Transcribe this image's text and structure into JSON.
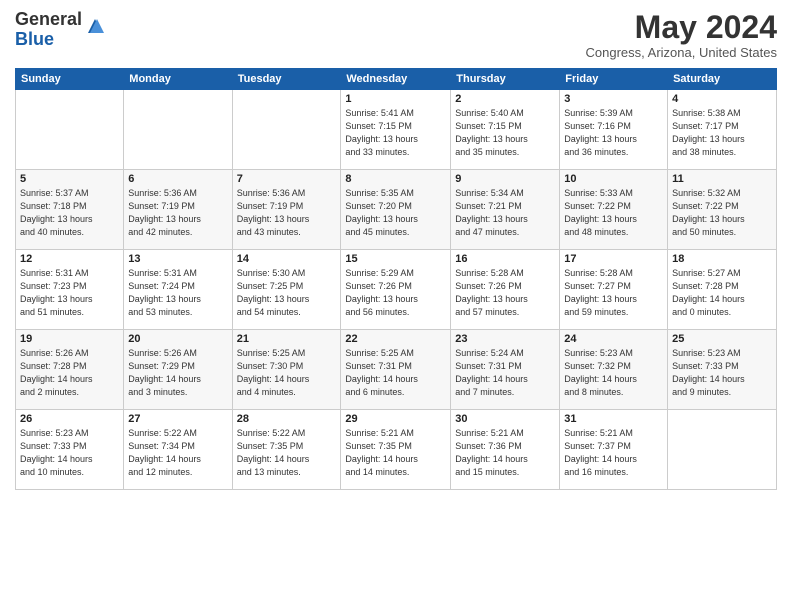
{
  "header": {
    "logo_general": "General",
    "logo_blue": "Blue",
    "month_title": "May 2024",
    "location": "Congress, Arizona, United States"
  },
  "days_of_week": [
    "Sunday",
    "Monday",
    "Tuesday",
    "Wednesday",
    "Thursday",
    "Friday",
    "Saturday"
  ],
  "weeks": [
    {
      "days": [
        {
          "number": "",
          "info": ""
        },
        {
          "number": "",
          "info": ""
        },
        {
          "number": "",
          "info": ""
        },
        {
          "number": "1",
          "info": "Sunrise: 5:41 AM\nSunset: 7:15 PM\nDaylight: 13 hours\nand 33 minutes."
        },
        {
          "number": "2",
          "info": "Sunrise: 5:40 AM\nSunset: 7:15 PM\nDaylight: 13 hours\nand 35 minutes."
        },
        {
          "number": "3",
          "info": "Sunrise: 5:39 AM\nSunset: 7:16 PM\nDaylight: 13 hours\nand 36 minutes."
        },
        {
          "number": "4",
          "info": "Sunrise: 5:38 AM\nSunset: 7:17 PM\nDaylight: 13 hours\nand 38 minutes."
        }
      ]
    },
    {
      "days": [
        {
          "number": "5",
          "info": "Sunrise: 5:37 AM\nSunset: 7:18 PM\nDaylight: 13 hours\nand 40 minutes."
        },
        {
          "number": "6",
          "info": "Sunrise: 5:36 AM\nSunset: 7:19 PM\nDaylight: 13 hours\nand 42 minutes."
        },
        {
          "number": "7",
          "info": "Sunrise: 5:36 AM\nSunset: 7:19 PM\nDaylight: 13 hours\nand 43 minutes."
        },
        {
          "number": "8",
          "info": "Sunrise: 5:35 AM\nSunset: 7:20 PM\nDaylight: 13 hours\nand 45 minutes."
        },
        {
          "number": "9",
          "info": "Sunrise: 5:34 AM\nSunset: 7:21 PM\nDaylight: 13 hours\nand 47 minutes."
        },
        {
          "number": "10",
          "info": "Sunrise: 5:33 AM\nSunset: 7:22 PM\nDaylight: 13 hours\nand 48 minutes."
        },
        {
          "number": "11",
          "info": "Sunrise: 5:32 AM\nSunset: 7:22 PM\nDaylight: 13 hours\nand 50 minutes."
        }
      ]
    },
    {
      "days": [
        {
          "number": "12",
          "info": "Sunrise: 5:31 AM\nSunset: 7:23 PM\nDaylight: 13 hours\nand 51 minutes."
        },
        {
          "number": "13",
          "info": "Sunrise: 5:31 AM\nSunset: 7:24 PM\nDaylight: 13 hours\nand 53 minutes."
        },
        {
          "number": "14",
          "info": "Sunrise: 5:30 AM\nSunset: 7:25 PM\nDaylight: 13 hours\nand 54 minutes."
        },
        {
          "number": "15",
          "info": "Sunrise: 5:29 AM\nSunset: 7:26 PM\nDaylight: 13 hours\nand 56 minutes."
        },
        {
          "number": "16",
          "info": "Sunrise: 5:28 AM\nSunset: 7:26 PM\nDaylight: 13 hours\nand 57 minutes."
        },
        {
          "number": "17",
          "info": "Sunrise: 5:28 AM\nSunset: 7:27 PM\nDaylight: 13 hours\nand 59 minutes."
        },
        {
          "number": "18",
          "info": "Sunrise: 5:27 AM\nSunset: 7:28 PM\nDaylight: 14 hours\nand 0 minutes."
        }
      ]
    },
    {
      "days": [
        {
          "number": "19",
          "info": "Sunrise: 5:26 AM\nSunset: 7:28 PM\nDaylight: 14 hours\nand 2 minutes."
        },
        {
          "number": "20",
          "info": "Sunrise: 5:26 AM\nSunset: 7:29 PM\nDaylight: 14 hours\nand 3 minutes."
        },
        {
          "number": "21",
          "info": "Sunrise: 5:25 AM\nSunset: 7:30 PM\nDaylight: 14 hours\nand 4 minutes."
        },
        {
          "number": "22",
          "info": "Sunrise: 5:25 AM\nSunset: 7:31 PM\nDaylight: 14 hours\nand 6 minutes."
        },
        {
          "number": "23",
          "info": "Sunrise: 5:24 AM\nSunset: 7:31 PM\nDaylight: 14 hours\nand 7 minutes."
        },
        {
          "number": "24",
          "info": "Sunrise: 5:23 AM\nSunset: 7:32 PM\nDaylight: 14 hours\nand 8 minutes."
        },
        {
          "number": "25",
          "info": "Sunrise: 5:23 AM\nSunset: 7:33 PM\nDaylight: 14 hours\nand 9 minutes."
        }
      ]
    },
    {
      "days": [
        {
          "number": "26",
          "info": "Sunrise: 5:23 AM\nSunset: 7:33 PM\nDaylight: 14 hours\nand 10 minutes."
        },
        {
          "number": "27",
          "info": "Sunrise: 5:22 AM\nSunset: 7:34 PM\nDaylight: 14 hours\nand 12 minutes."
        },
        {
          "number": "28",
          "info": "Sunrise: 5:22 AM\nSunset: 7:35 PM\nDaylight: 14 hours\nand 13 minutes."
        },
        {
          "number": "29",
          "info": "Sunrise: 5:21 AM\nSunset: 7:35 PM\nDaylight: 14 hours\nand 14 minutes."
        },
        {
          "number": "30",
          "info": "Sunrise: 5:21 AM\nSunset: 7:36 PM\nDaylight: 14 hours\nand 15 minutes."
        },
        {
          "number": "31",
          "info": "Sunrise: 5:21 AM\nSunset: 7:37 PM\nDaylight: 14 hours\nand 16 minutes."
        },
        {
          "number": "",
          "info": ""
        }
      ]
    }
  ]
}
